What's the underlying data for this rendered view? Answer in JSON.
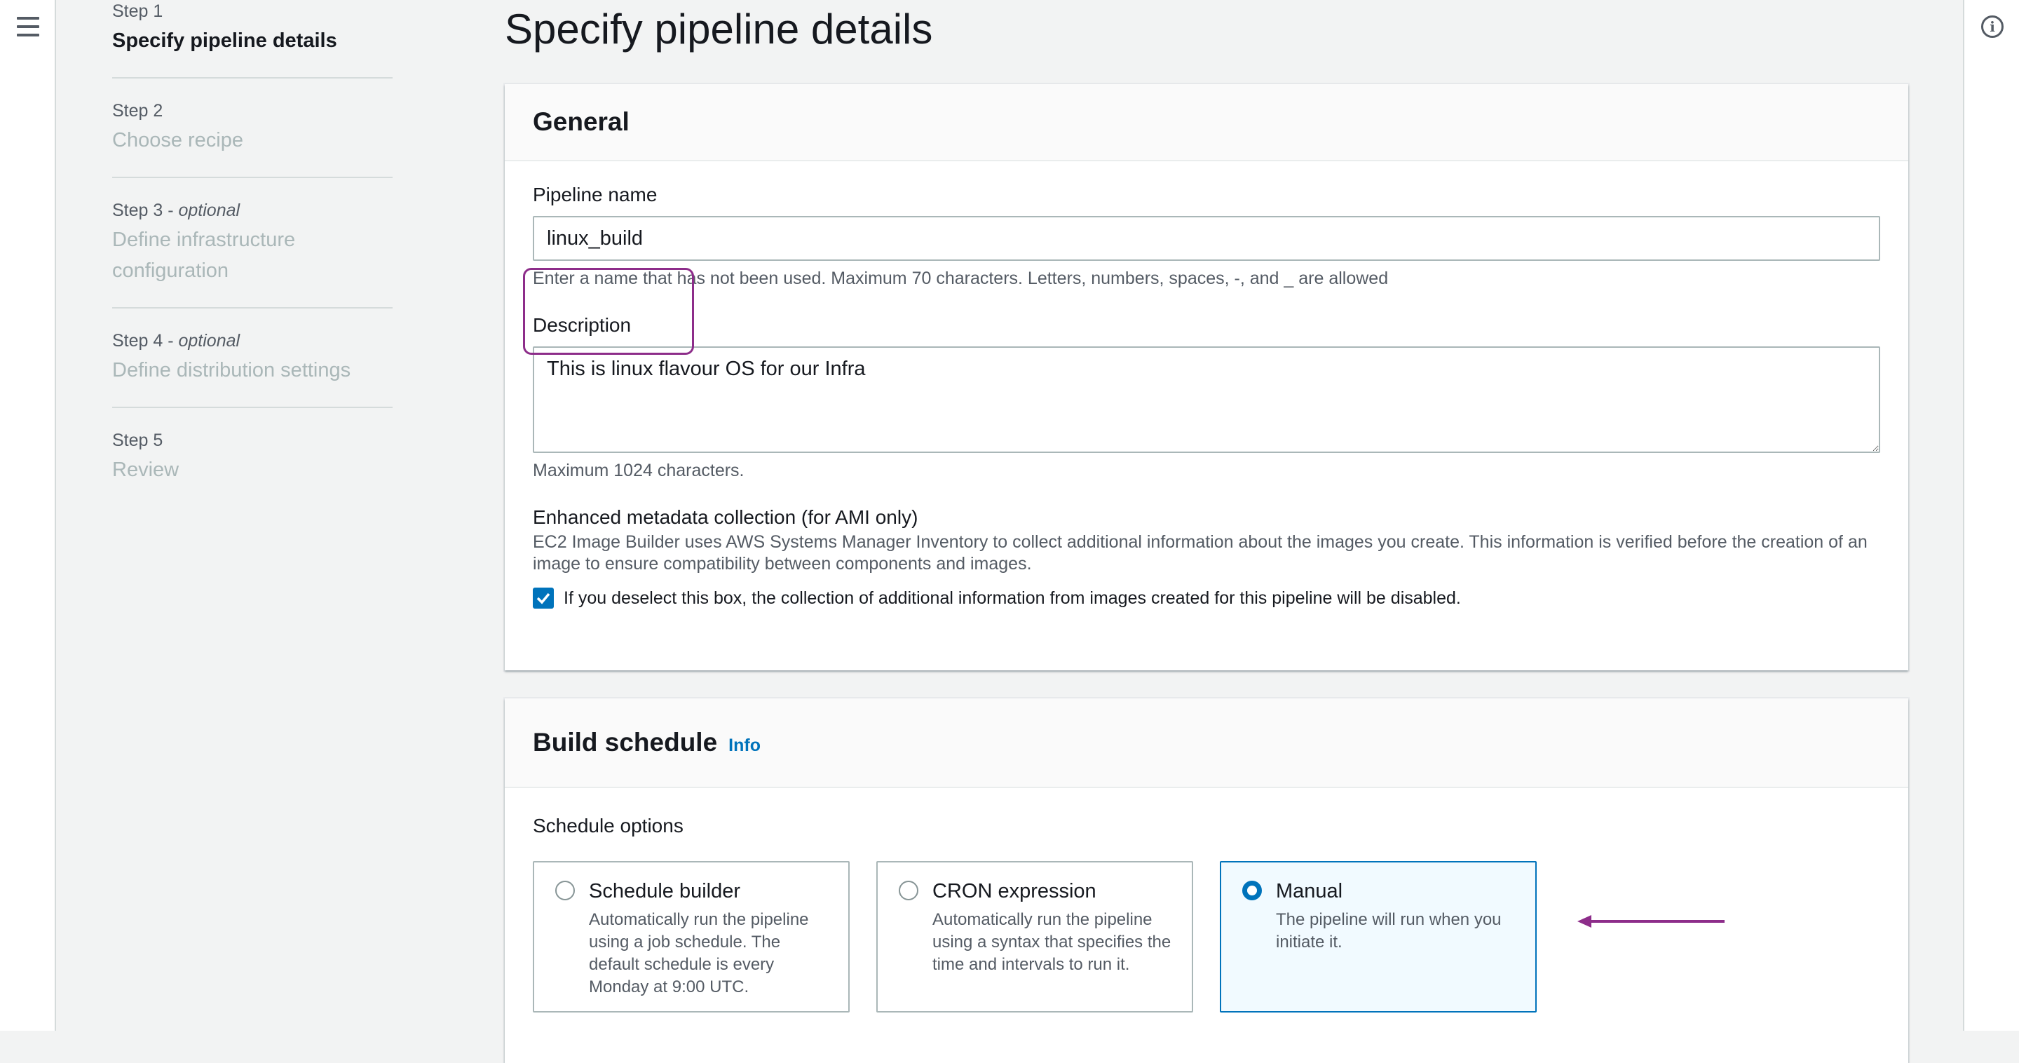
{
  "steps": [
    {
      "number": "Step 1",
      "optional": "",
      "title": "Specify pipeline details"
    },
    {
      "number": "Step 2",
      "optional": "",
      "title": "Choose recipe"
    },
    {
      "number": "Step 3 - ",
      "optional": "optional",
      "title": "Define infrastructure configuration"
    },
    {
      "number": "Step 4 - ",
      "optional": "optional",
      "title": "Define distribution settings"
    },
    {
      "number": "Step 5",
      "optional": "",
      "title": "Review"
    }
  ],
  "page_title": "Specify pipeline details",
  "general": {
    "header": "General",
    "pipeline_name_label": "Pipeline name",
    "pipeline_name_value": "linux_build",
    "pipeline_name_hint": "Enter a name that has not been used. Maximum 70 characters. Letters, numbers, spaces, -, and _ are allowed",
    "description_label": "Description",
    "description_value": "This is linux flavour OS for our Infra",
    "description_hint": "Maximum 1024 characters.",
    "metadata_label": "Enhanced metadata collection (for AMI only)",
    "metadata_desc": "EC2 Image Builder uses AWS Systems Manager Inventory to collect additional information about the images you create. This information is verified before the creation of an image to ensure compatibility between components and images.",
    "metadata_checkbox_label": "If you deselect this box, the collection of additional information from images created for this pipeline will be disabled.",
    "metadata_checked": true
  },
  "build_schedule": {
    "header": "Build schedule",
    "info_link": "Info",
    "options_label": "Schedule options",
    "options": [
      {
        "title": "Schedule builder",
        "desc": "Automatically run the pipeline using a job schedule. The default schedule is every Monday at 9:00 UTC.",
        "selected": false
      },
      {
        "title": "CRON expression",
        "desc": "Automatically run the pipeline using a syntax that specifies the time and intervals to run it.",
        "selected": false
      },
      {
        "title": "Manual",
        "desc": "The pipeline will run when you initiate it.",
        "selected": true
      }
    ]
  },
  "colors": {
    "annotation": "#8d2d8a",
    "accent": "#0073bb"
  },
  "icons": {
    "menu": "hamburger-menu-icon",
    "info": "info-circle-icon",
    "check": "checkmark-icon",
    "arrow": "annotation-arrow-icon"
  }
}
